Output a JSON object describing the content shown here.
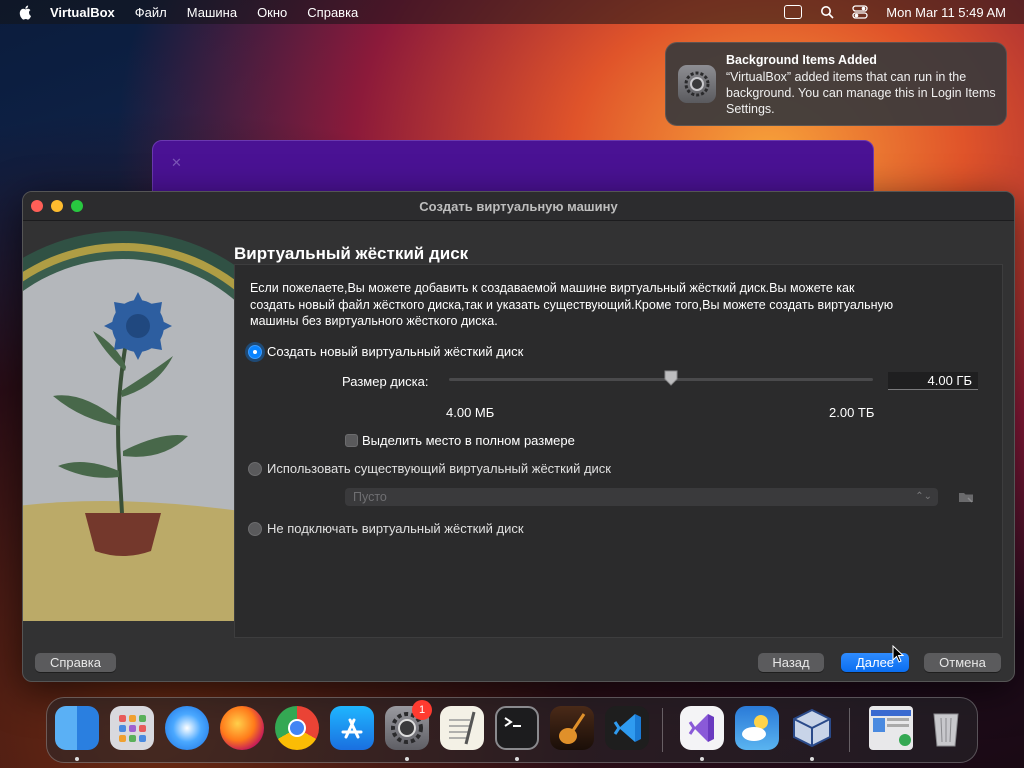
{
  "menubar": {
    "app": "VirtualBox",
    "items": [
      "Файл",
      "Машина",
      "Окно",
      "Справка"
    ],
    "clock": "Mon Mar 11  5:49 AM"
  },
  "notification": {
    "title": "Background Items Added",
    "body": "“VirtualBox” added items that can run in the background. You can manage this in Login Items Settings."
  },
  "dialog": {
    "title": "Создать виртуальную машину",
    "heading": "Виртуальный жёсткий диск",
    "description": "Если пожелаете,Вы можете добавить к создаваемой машине виртуальный жёсткий диск.Вы можете как создать новый файл жёсткого диска,так и указать существующий.Кроме того,Вы можете создать виртуальную машины без виртуального жёсткого диска.",
    "option_create": "Создать новый виртуальный жёсткий диск",
    "disk_size_label": "Размер диска:",
    "disk_size_value": "4.00 ГБ",
    "slider_min": "4.00 МБ",
    "slider_max": "2.00 ТБ",
    "preallocate_label": "Выделить место в полном размере",
    "option_existing": "Использовать существующий виртуальный жёсткий диск",
    "existing_combo": "Пусто",
    "option_none": "Не подключать виртуальный жёсткий диск",
    "buttons": {
      "help": "Справка",
      "back": "Назад",
      "next": "Далее",
      "cancel": "Отмена"
    }
  },
  "dock": {
    "settings_badge": "1",
    "apps": [
      "finder-icon",
      "launchpad-icon",
      "safari-icon",
      "firefox-icon",
      "chrome-icon",
      "app-store-icon",
      "system-settings-icon",
      "textedit-icon",
      "terminal-icon",
      "garageband-icon",
      "vscode-icon",
      "visual-studio-icon",
      "weather-icon",
      "virtualbox-icon",
      "preview-window-icon",
      "trash-icon"
    ]
  }
}
